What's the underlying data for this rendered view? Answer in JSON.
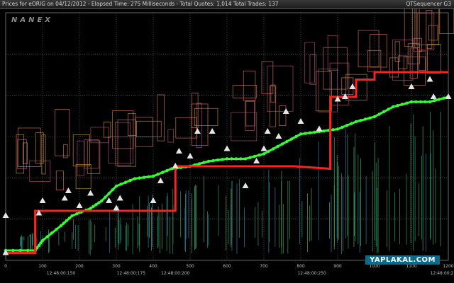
{
  "header": {
    "title": "Prices for  eORIG  on  04/12/2012  -  Elapsed Time: 275 Milliseconds  -  Total Quotes: 1,014  Total Trades: 137",
    "app": "QTSequencer G3"
  },
  "logo": "NANEX",
  "watermark": "YAPLAKAL.COM",
  "colors": {
    "background": "#000000",
    "bid_trades": "#33ff33",
    "ask_trades": "#ff2020",
    "marker_triangle": "#e6e6e6",
    "quotes_high": "#d2785a",
    "quotes_low": "#2aa06e",
    "grid": "#6a6a6a"
  },
  "chart_data": {
    "type": "line",
    "title": "",
    "xlabel": "",
    "ylabel": "",
    "xlim": [
      0,
      1200
    ],
    "ylim": [
      0,
      100
    ],
    "grid": true,
    "x_ticks": [
      0,
      100,
      200,
      300,
      400,
      500,
      600,
      700,
      800,
      900,
      1000,
      1100,
      1200
    ],
    "time_labels": [
      {
        "x": 150,
        "label": "12:48:00:150"
      },
      {
        "x": 340,
        "label": "12:48:00:175"
      },
      {
        "x": 460,
        "label": "12:48:00:200"
      },
      {
        "x": 830,
        "label": "12:48:00:250"
      },
      {
        "x": 1190,
        "label": "12:48:00:275"
      }
    ],
    "series": [
      {
        "role": "bid",
        "color": "#33ff33",
        "points": [
          [
            0,
            4
          ],
          [
            80,
            4
          ],
          [
            100,
            8
          ],
          [
            150,
            14
          ],
          [
            180,
            18
          ],
          [
            230,
            21
          ],
          [
            260,
            24
          ],
          [
            300,
            30
          ],
          [
            350,
            33
          ],
          [
            400,
            34
          ],
          [
            450,
            37
          ],
          [
            500,
            38
          ],
          [
            550,
            40
          ],
          [
            600,
            41
          ],
          [
            650,
            41
          ],
          [
            700,
            43
          ],
          [
            750,
            47
          ],
          [
            800,
            51
          ],
          [
            850,
            52
          ],
          [
            900,
            53
          ],
          [
            950,
            56
          ],
          [
            1000,
            58
          ],
          [
            1050,
            62
          ],
          [
            1100,
            64
          ],
          [
            1150,
            64
          ],
          [
            1200,
            66
          ]
        ]
      },
      {
        "role": "ask",
        "color": "#ff2020",
        "points": [
          [
            0,
            3
          ],
          [
            80,
            3
          ],
          [
            80,
            20
          ],
          [
            160,
            20
          ],
          [
            460,
            20
          ],
          [
            460,
            38
          ],
          [
            780,
            38
          ],
          [
            880,
            37
          ],
          [
            880,
            66
          ],
          [
            950,
            66
          ],
          [
            950,
            73
          ],
          [
            1000,
            73
          ],
          [
            1000,
            76
          ],
          [
            1200,
            76
          ]
        ]
      }
    ],
    "markers": [
      [
        0,
        18
      ],
      [
        0,
        3
      ],
      [
        90,
        19
      ],
      [
        100,
        24
      ],
      [
        160,
        25
      ],
      [
        170,
        28
      ],
      [
        200,
        22
      ],
      [
        230,
        27
      ],
      [
        280,
        24
      ],
      [
        300,
        21
      ],
      [
        310,
        25
      ],
      [
        400,
        24
      ],
      [
        420,
        32
      ],
      [
        460,
        38
      ],
      [
        470,
        44
      ],
      [
        500,
        42
      ],
      [
        520,
        52
      ],
      [
        560,
        52
      ],
      [
        600,
        45
      ],
      [
        650,
        30
      ],
      [
        680,
        40
      ],
      [
        700,
        45
      ],
      [
        710,
        52
      ],
      [
        740,
        50
      ],
      [
        760,
        60
      ],
      [
        800,
        56
      ],
      [
        850,
        53
      ],
      [
        900,
        65
      ],
      [
        920,
        66
      ],
      [
        940,
        70
      ],
      [
        1100,
        70
      ],
      [
        1150,
        73
      ],
      [
        1160,
        66
      ],
      [
        1200,
        66
      ]
    ]
  }
}
